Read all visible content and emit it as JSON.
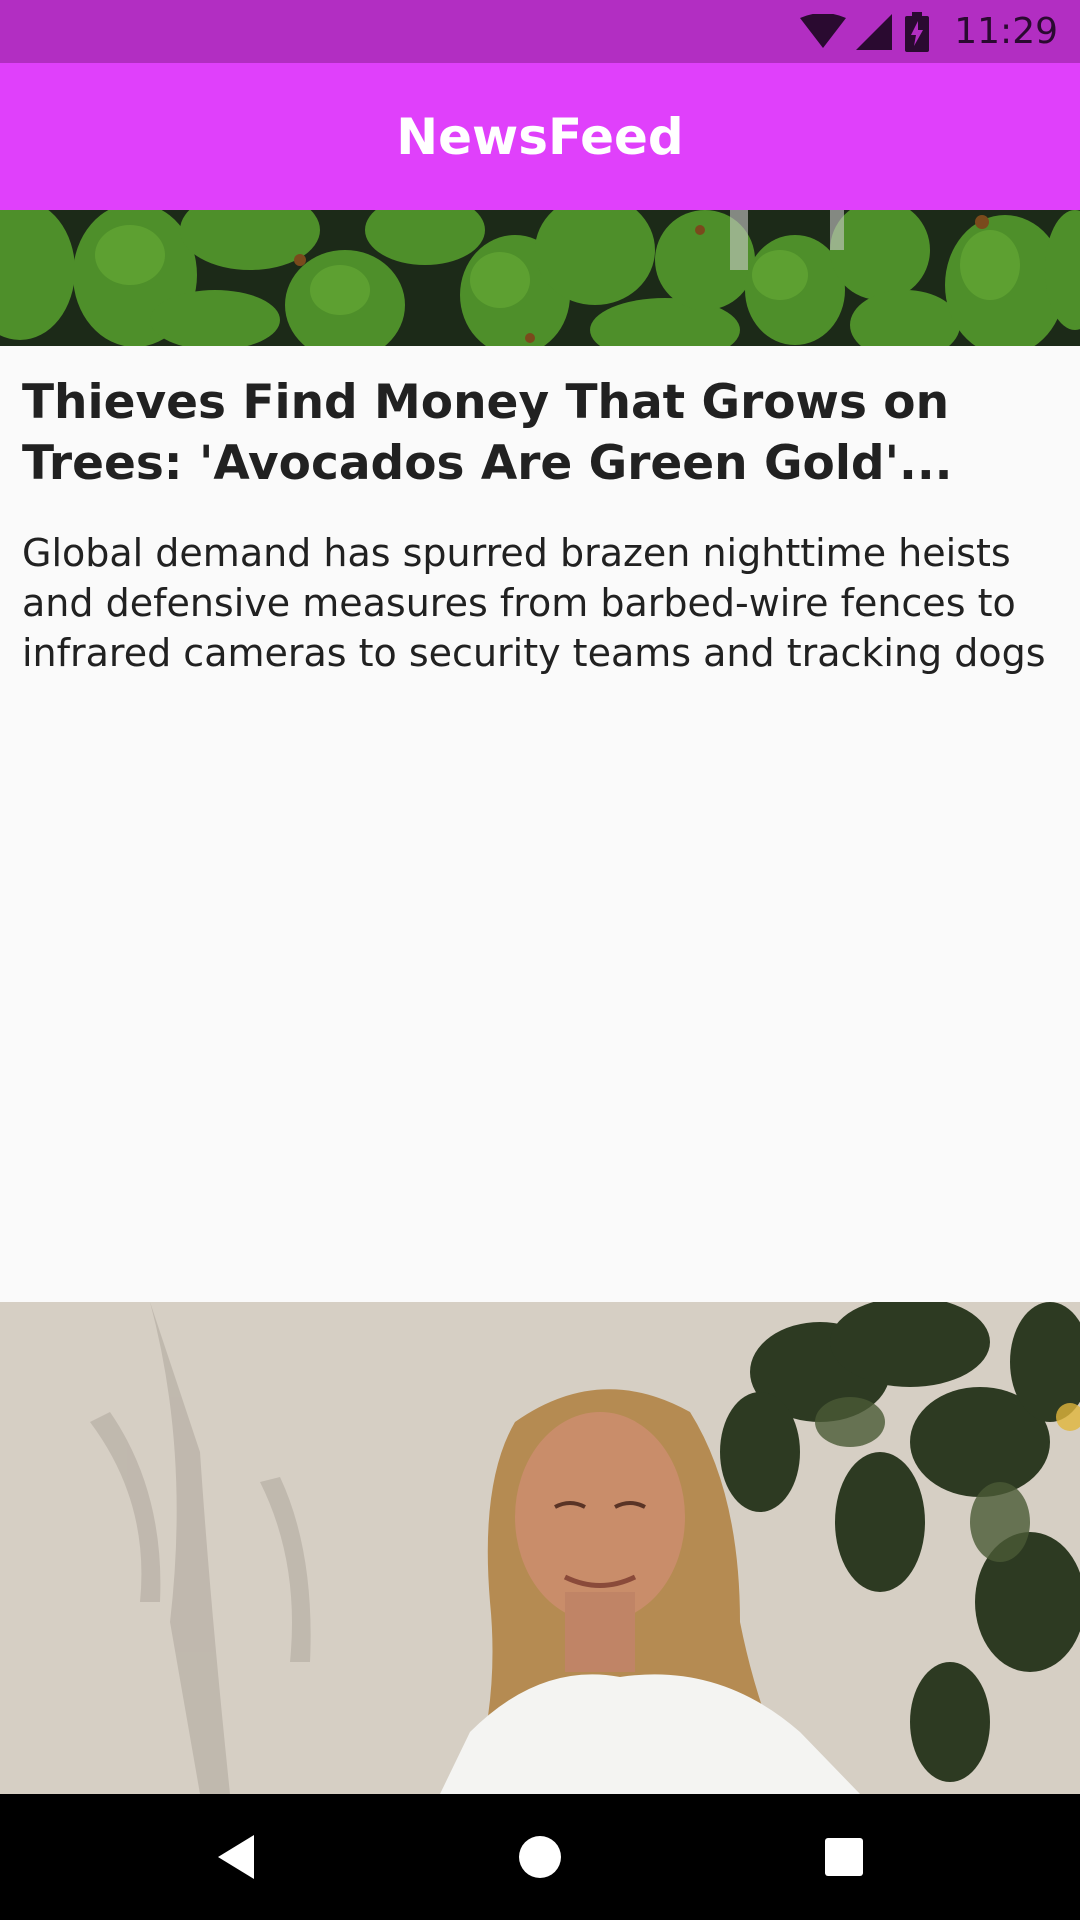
{
  "status_bar": {
    "time": "11:29",
    "icons": [
      "wifi-icon",
      "cell-signal-icon",
      "battery-charging-icon"
    ]
  },
  "app_bar": {
    "title": "NewsFeed"
  },
  "articles": [
    {
      "image": "avocados-photo",
      "title": "Thieves Find Money That Grows on Trees: 'Avocados Are Green Gold'...",
      "description": "Global demand has spurred brazen nighttime heists and defensive measures from barbed-wire fences to infrared cameras to security teams and tracking dogs"
    },
    {
      "image": "woman-portrait-photo"
    }
  ],
  "nav_bar": {
    "icons": [
      "back-icon",
      "home-icon",
      "recents-icon"
    ]
  },
  "colors": {
    "status_bar": "#b22ec2",
    "app_bar": "#e040fb",
    "background": "#fafafa",
    "text": "#212121",
    "nav_bar": "#000000"
  }
}
